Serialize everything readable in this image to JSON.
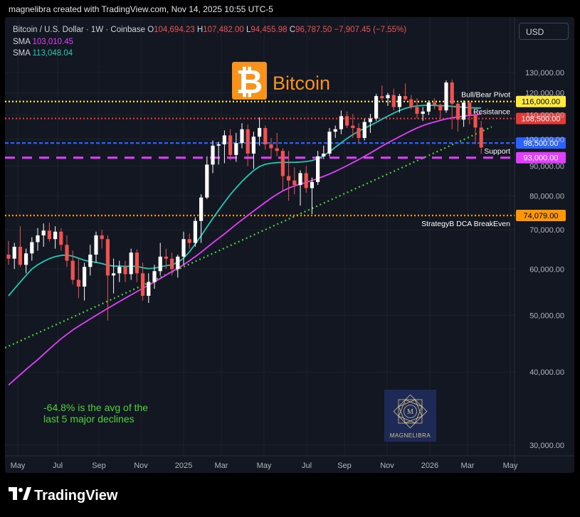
{
  "header": {
    "attribution": "magnelibra created with TradingView.com, Nov 14, 2025 10:55 UTC-5"
  },
  "legend": {
    "symbol": "Bitcoin / U.S. Dollar · 1W · Coinbase",
    "open_label": "O",
    "open": "104,694.23",
    "high_label": "H",
    "high": "107,482.00",
    "low_label": "L",
    "low": "94,455.98",
    "close_label": "C",
    "close": "96,787.50",
    "change": "−7,907.45 (−7.55%)",
    "sma1_label": "SMA",
    "sma1_value": "103,010.45",
    "sma1_color": "#e040fb",
    "sma2_label": "SMA",
    "sma2_value": "113,048.04",
    "sma2_color": "#26c6b4"
  },
  "currency_button": "USD",
  "title_overlay": {
    "text": "Bitcoin",
    "logo": "bitcoin-logo",
    "color": "#f7931a"
  },
  "watermark_logo": {
    "text": "MAGNELIBRA"
  },
  "annotation": "-64.8% is the avg of the\nlast 5 major declines",
  "footer": {
    "brand": "TradingView"
  },
  "chart_data": {
    "type": "candlestick",
    "interval": "1W",
    "ylim": [
      25000,
      140000
    ],
    "y_ticks": [
      30000,
      40000,
      50000,
      60000,
      70000,
      80000,
      90000,
      100000,
      110000,
      120000,
      130000
    ],
    "y_tick_labels": [
      "30,000.00",
      "40,000.00",
      "50,000.00",
      "60,000.00",
      "70,000.00",
      "80,000.00",
      "90,000.00",
      "100,000.00",
      "110,000.00",
      "120,000.00",
      "130,000.00"
    ],
    "x_tick_labels": [
      "May",
      "Jul",
      "Sep",
      "Nov",
      "2025",
      "Mar",
      "May",
      "Jul",
      "Sep",
      "Nov",
      "2026",
      "Mar",
      "May"
    ],
    "up_color": "#ffffff",
    "down_color": "#ef5350",
    "candles": [
      {
        "o": 63500,
        "h": 67000,
        "l": 61000,
        "c": 62500
      },
      {
        "o": 62500,
        "h": 66500,
        "l": 60000,
        "c": 65500
      },
      {
        "o": 65500,
        "h": 71000,
        "l": 60500,
        "c": 61000
      },
      {
        "o": 61000,
        "h": 65000,
        "l": 59000,
        "c": 63800
      },
      {
        "o": 63800,
        "h": 68000,
        "l": 62000,
        "c": 66700
      },
      {
        "o": 66700,
        "h": 70500,
        "l": 64500,
        "c": 68500
      },
      {
        "o": 68500,
        "h": 71800,
        "l": 65500,
        "c": 69800
      },
      {
        "o": 69800,
        "h": 72000,
        "l": 66800,
        "c": 67500
      },
      {
        "o": 67500,
        "h": 71000,
        "l": 65000,
        "c": 69500
      },
      {
        "o": 69500,
        "h": 70500,
        "l": 64500,
        "c": 66000
      },
      {
        "o": 66000,
        "h": 68500,
        "l": 60500,
        "c": 62000
      },
      {
        "o": 62000,
        "h": 64500,
        "l": 56500,
        "c": 57500
      },
      {
        "o": 57500,
        "h": 62500,
        "l": 53500,
        "c": 56000
      },
      {
        "o": 56000,
        "h": 61500,
        "l": 53000,
        "c": 60500
      },
      {
        "o": 60500,
        "h": 66000,
        "l": 58500,
        "c": 63500
      },
      {
        "o": 63500,
        "h": 69500,
        "l": 61500,
        "c": 68500
      },
      {
        "o": 68500,
        "h": 70000,
        "l": 65000,
        "c": 67500
      },
      {
        "o": 67500,
        "h": 68500,
        "l": 49000,
        "c": 58500
      },
      {
        "o": 58500,
        "h": 62500,
        "l": 54500,
        "c": 59000
      },
      {
        "o": 59000,
        "h": 62000,
        "l": 57000,
        "c": 60500
      },
      {
        "o": 60500,
        "h": 62000,
        "l": 57000,
        "c": 58800
      },
      {
        "o": 58800,
        "h": 65000,
        "l": 57500,
        "c": 64000
      },
      {
        "o": 64000,
        "h": 64800,
        "l": 57000,
        "c": 59000
      },
      {
        "o": 59000,
        "h": 61500,
        "l": 53000,
        "c": 54000
      },
      {
        "o": 54000,
        "h": 59000,
        "l": 52500,
        "c": 57000
      },
      {
        "o": 57000,
        "h": 61000,
        "l": 55500,
        "c": 59500
      },
      {
        "o": 59500,
        "h": 66500,
        "l": 58500,
        "c": 63000
      },
      {
        "o": 63000,
        "h": 65000,
        "l": 60000,
        "c": 62500
      },
      {
        "o": 62500,
        "h": 64000,
        "l": 58500,
        "c": 60000
      },
      {
        "o": 60000,
        "h": 63500,
        "l": 58000,
        "c": 63000
      },
      {
        "o": 63000,
        "h": 69500,
        "l": 61000,
        "c": 67500
      },
      {
        "o": 67500,
        "h": 69000,
        "l": 65000,
        "c": 66500
      },
      {
        "o": 66500,
        "h": 73500,
        "l": 65500,
        "c": 72500
      },
      {
        "o": 72500,
        "h": 80500,
        "l": 66500,
        "c": 79500
      },
      {
        "o": 79500,
        "h": 93500,
        "l": 79000,
        "c": 90500
      },
      {
        "o": 90500,
        "h": 99500,
        "l": 87500,
        "c": 97500
      },
      {
        "o": 97500,
        "h": 99000,
        "l": 90500,
        "c": 98000
      },
      {
        "o": 98000,
        "h": 103500,
        "l": 91000,
        "c": 101500
      },
      {
        "o": 101500,
        "h": 104000,
        "l": 92000,
        "c": 94000
      },
      {
        "o": 94000,
        "h": 102500,
        "l": 91500,
        "c": 98500
      },
      {
        "o": 98500,
        "h": 106500,
        "l": 96500,
        "c": 104000
      },
      {
        "o": 104000,
        "h": 106000,
        "l": 90000,
        "c": 94500
      },
      {
        "o": 94500,
        "h": 103000,
        "l": 89000,
        "c": 101000
      },
      {
        "o": 101000,
        "h": 109000,
        "l": 97500,
        "c": 104500
      },
      {
        "o": 104500,
        "h": 105500,
        "l": 96000,
        "c": 98000
      },
      {
        "o": 98000,
        "h": 100500,
        "l": 92500,
        "c": 96500
      },
      {
        "o": 96500,
        "h": 102500,
        "l": 93500,
        "c": 95500
      },
      {
        "o": 95500,
        "h": 96500,
        "l": 81500,
        "c": 86500
      },
      {
        "o": 86500,
        "h": 95500,
        "l": 78500,
        "c": 85000
      },
      {
        "o": 85000,
        "h": 89500,
        "l": 80500,
        "c": 83500
      },
      {
        "o": 83500,
        "h": 88500,
        "l": 77000,
        "c": 87500
      },
      {
        "o": 87500,
        "h": 90000,
        "l": 81000,
        "c": 82500
      },
      {
        "o": 82500,
        "h": 86000,
        "l": 74500,
        "c": 84500
      },
      {
        "o": 84500,
        "h": 95500,
        "l": 83500,
        "c": 93500
      },
      {
        "o": 93500,
        "h": 97500,
        "l": 92500,
        "c": 94500
      },
      {
        "o": 94500,
        "h": 104500,
        "l": 93500,
        "c": 103000
      },
      {
        "o": 103000,
        "h": 105500,
        "l": 100500,
        "c": 104000
      },
      {
        "o": 104000,
        "h": 112000,
        "l": 102000,
        "c": 109500
      },
      {
        "o": 109500,
        "h": 111500,
        "l": 104500,
        "c": 105500
      },
      {
        "o": 105500,
        "h": 110500,
        "l": 100500,
        "c": 104500
      },
      {
        "o": 104500,
        "h": 106500,
        "l": 98500,
        "c": 100500
      },
      {
        "o": 100500,
        "h": 108500,
        "l": 99500,
        "c": 107000
      },
      {
        "o": 107000,
        "h": 110500,
        "l": 102500,
        "c": 108500
      },
      {
        "o": 108500,
        "h": 119500,
        "l": 107500,
        "c": 118500
      },
      {
        "o": 118500,
        "h": 123500,
        "l": 116500,
        "c": 117500
      },
      {
        "o": 117500,
        "h": 120000,
        "l": 114000,
        "c": 119000
      },
      {
        "o": 119000,
        "h": 122000,
        "l": 112000,
        "c": 113500
      },
      {
        "o": 113500,
        "h": 119500,
        "l": 111000,
        "c": 118500
      },
      {
        "o": 118500,
        "h": 124500,
        "l": 116500,
        "c": 117000
      },
      {
        "o": 117000,
        "h": 119000,
        "l": 112500,
        "c": 113500
      },
      {
        "o": 113500,
        "h": 117500,
        "l": 108500,
        "c": 110500
      },
      {
        "o": 110500,
        "h": 113500,
        "l": 107500,
        "c": 111500
      },
      {
        "o": 111500,
        "h": 116500,
        "l": 110000,
        "c": 115500
      },
      {
        "o": 115500,
        "h": 117500,
        "l": 112500,
        "c": 114500
      },
      {
        "o": 114500,
        "h": 115000,
        "l": 108500,
        "c": 112000
      },
      {
        "o": 112000,
        "h": 126000,
        "l": 111000,
        "c": 125000
      },
      {
        "o": 125000,
        "h": 126500,
        "l": 104000,
        "c": 115000
      },
      {
        "o": 115000,
        "h": 116000,
        "l": 103000,
        "c": 108000
      },
      {
        "o": 108000,
        "h": 116500,
        "l": 105000,
        "c": 115500
      },
      {
        "o": 115500,
        "h": 116500,
        "l": 106000,
        "c": 110000
      },
      {
        "o": 110000,
        "h": 111500,
        "l": 98000,
        "c": 104700
      },
      {
        "o": 104694,
        "h": 107482,
        "l": 94456,
        "c": 96788
      }
    ],
    "series": [
      {
        "name": "SMA",
        "value": "103,010.45",
        "color": "#e040fb",
        "values": [
          38000,
          38800,
          39600,
          40400,
          41200,
          42000,
          42900,
          43800,
          44700,
          45600,
          46400,
          47200,
          47900,
          48600,
          49300,
          50000,
          50700,
          51400,
          52100,
          52800,
          53500,
          54200,
          54900,
          55600,
          56300,
          57000,
          57800,
          58600,
          59400,
          60200,
          61000,
          62000,
          63000,
          64100,
          65300,
          66500,
          67700,
          68900,
          70200,
          71500,
          72800,
          74100,
          75400,
          76700,
          78000,
          79300,
          80500,
          81600,
          82500,
          83200,
          83800,
          84400,
          85000,
          85700,
          86400,
          87200,
          88100,
          89100,
          90100,
          91200,
          92300,
          93500,
          94700,
          96000,
          97300,
          98600,
          99800,
          101000,
          102200,
          103400,
          104500,
          105500,
          106300,
          107000,
          107700,
          108300,
          108800,
          109200,
          109500,
          109800,
          110000,
          110500
        ]
      },
      {
        "name": "SMA",
        "value": "113,048.04",
        "color": "#26c6b4",
        "values": [
          54000,
          55500,
          57000,
          58500,
          60000,
          61000,
          61800,
          62500,
          63000,
          63300,
          63400,
          63100,
          62600,
          62100,
          61800,
          61600,
          61300,
          60900,
          60700,
          60700,
          60600,
          60700,
          60600,
          60300,
          60100,
          60200,
          60500,
          60800,
          61000,
          61600,
          62600,
          64200,
          66200,
          68400,
          70800,
          73200,
          75600,
          78000,
          80400,
          82600,
          84700,
          86600,
          88400,
          89800,
          90600,
          91000,
          91200,
          91300,
          91300,
          91300,
          91400,
          91600,
          91900,
          92600,
          93700,
          95200,
          96900,
          98600,
          100300,
          101800,
          103200,
          104400,
          105600,
          106800,
          108200,
          109500,
          110800,
          112000,
          112900,
          113600,
          114000,
          114200,
          114300,
          114200,
          114100,
          114000,
          113800,
          113600,
          113400,
          113200,
          113100,
          113048
        ]
      }
    ],
    "horizontal_levels": [
      {
        "label": "Bull/Bear Pivot",
        "price": 116000,
        "price_label": "116,000.00",
        "color": "#ffeb3b"
      },
      {
        "label": "Resistance",
        "price": 108500,
        "price_label": "108,500.00",
        "color": "#e53935"
      },
      {
        "label": "Support",
        "price": 98500,
        "price_label": "98,500.00",
        "color": "#2962ff"
      },
      {
        "label": "",
        "price": 93000,
        "price_label": "93,000.00",
        "color": "#e040fb"
      },
      {
        "label": "StrategyB DCA BreakEven",
        "price": 74079,
        "price_label": "74,079.00",
        "color": "#ff9800"
      }
    ],
    "trendline": {
      "color": "#4cd137",
      "y_start": 44000,
      "y_end": 105000
    }
  }
}
